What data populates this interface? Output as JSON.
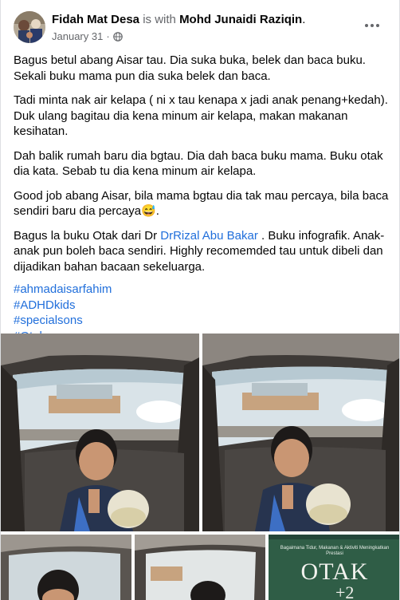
{
  "post": {
    "author": "Fidah Mat Desa",
    "with_text": "is with",
    "tagged": "Mohd Junaidi Raziqin",
    "tagged_suffix": ".",
    "date": "January 31",
    "separator": "·",
    "privacy_icon": "globe-icon",
    "more_icon": "more-options-icon",
    "paragraphs": [
      "Bagus betul abang Aisar tau. Dia suka buka, belek dan baca buku. Sekali buku mama pun dia suka belek dan baca.",
      "Tadi minta nak air kelapa ( ni x tau kenapa x jadi anak penang+kedah). Duk ulang bagitau dia kena minum air kelapa, makan makanan kesihatan.",
      "Dah balik rumah baru dia bgtau. Dia dah baca buku mama. Buku otak dia kata. Sebab tu dia kena minum air kelapa.",
      " Good job abang Aisar, bila mama bgtau dia tak mau percaya, bila baca sendiri baru dia percaya😅."
    ],
    "last_paragraph": {
      "before_link": "Bagus la buku Otak dari Dr ",
      "link": "DrRizal Abu Bakar",
      "after_link": " . Buku infografik. Anak-anak pun boleh baca sendiri. Highly recomemded tau untuk dibeli dan dijadikan bahan bacaan sekeluarga."
    },
    "hashtags": [
      "#ahmadaisarfahim",
      "#ADHDkids",
      "#specialsons",
      "#Otak"
    ]
  },
  "photos": {
    "book_title": "OTAK",
    "book_subtitle": "Bagaimana Tidur, Makanan & Aktiviti Meningkatkan Prestasi",
    "book_partial": "+2"
  },
  "colors": {
    "link": "#216fdb",
    "text": "#050505",
    "secondary": "#65676b"
  }
}
